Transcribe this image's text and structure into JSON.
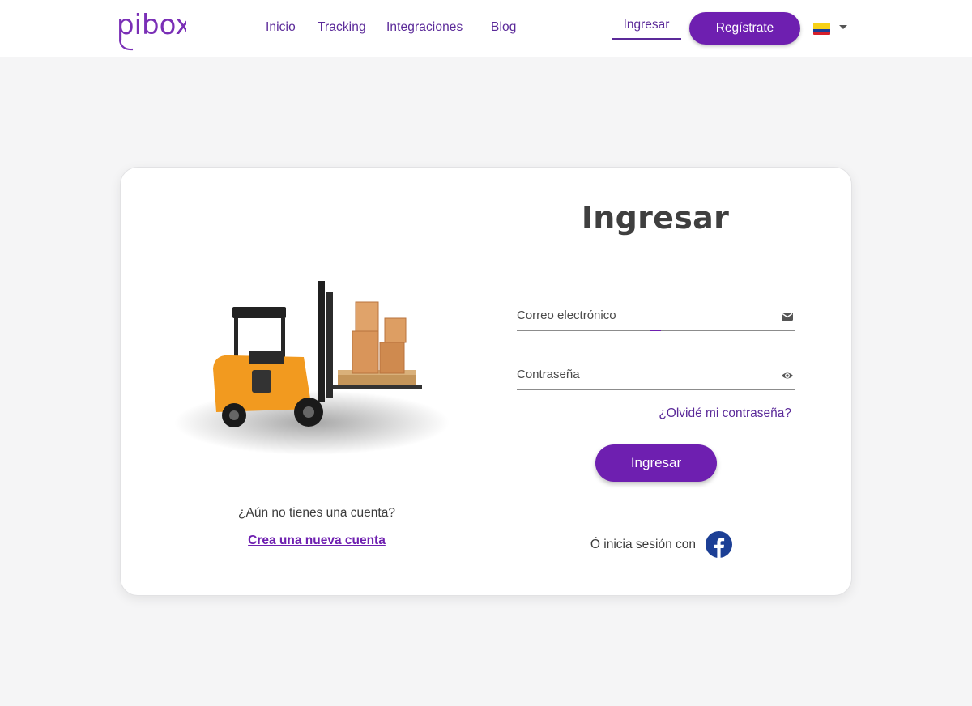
{
  "brand": {
    "name": "pibox",
    "accent": "#6e1fb0",
    "nav_color": "#5b2a99"
  },
  "nav": {
    "links": [
      "Inicio",
      "Tracking",
      "Integraciones",
      "Blog"
    ],
    "login_label": "Ingresar",
    "register_label": "Regístrate",
    "country_flag": "colombia-flag-icon"
  },
  "left": {
    "illustration": "forklift-with-boxes",
    "no_account_text": "¿Aún no tienes una cuenta?",
    "create_account_link": "Crea una nueva cuenta"
  },
  "form": {
    "title": "Ingresar",
    "email_label": "Correo electrónico",
    "email_icon": "mail-icon",
    "password_label": "Contraseña",
    "password_icon": "eye-icon",
    "forgot_link": "¿Olvidé mi contraseña?",
    "submit_label": "Ingresar",
    "social_text": "Ó inicia sesión con",
    "social_provider": "facebook-icon"
  }
}
